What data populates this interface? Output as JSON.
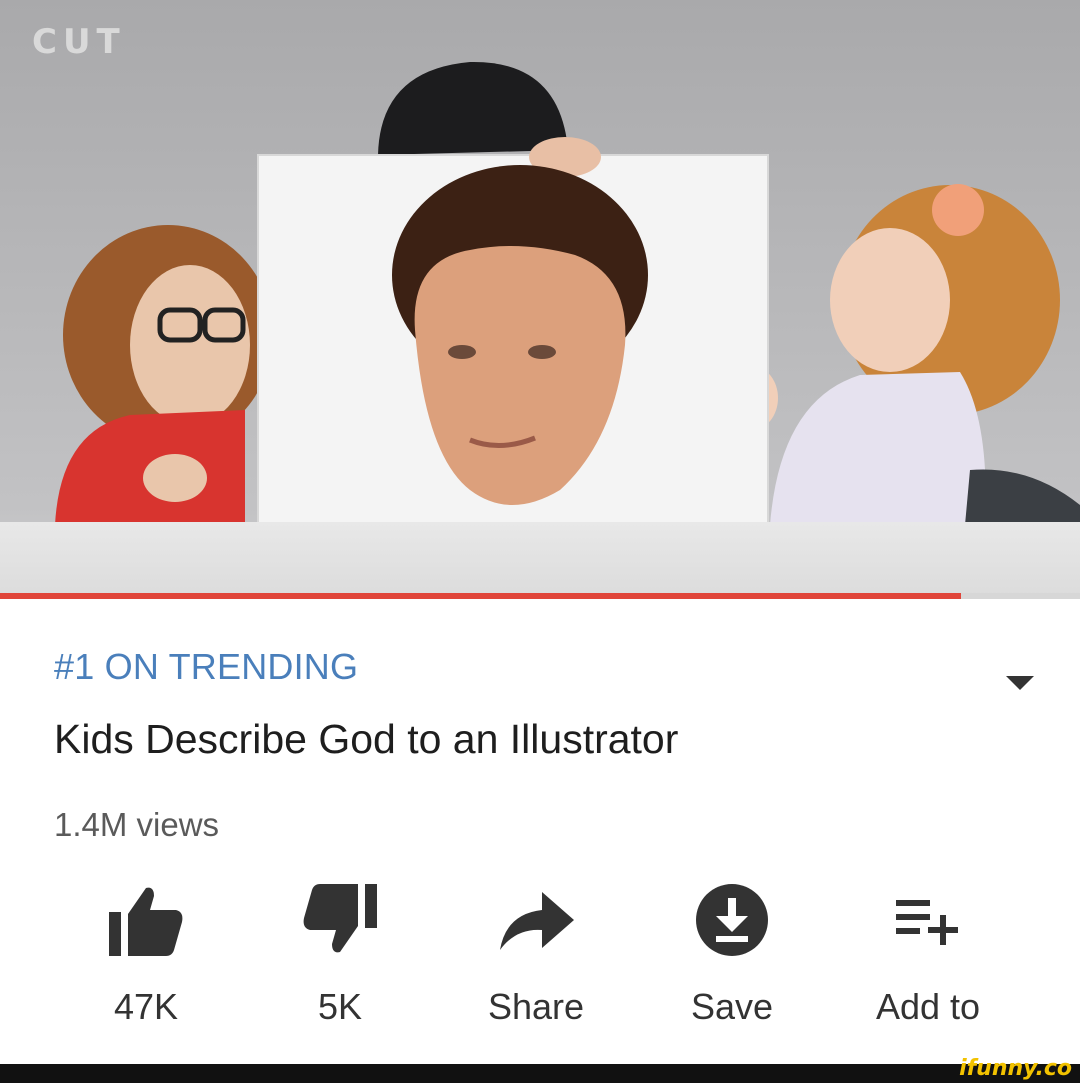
{
  "video": {
    "channel_logo": "CUT",
    "progress_fraction": 0.89
  },
  "info": {
    "trending": "#1 ON TRENDING",
    "title": "Kids Describe God to an Illustrator",
    "views": "1.4M views",
    "expand_icon": "chevron-down-icon"
  },
  "actions": [
    {
      "icon": "thumbs-up-icon",
      "label": "47K"
    },
    {
      "icon": "thumbs-down-icon",
      "label": "5K"
    },
    {
      "icon": "share-icon",
      "label": "Share"
    },
    {
      "icon": "download-icon",
      "label": "Save"
    },
    {
      "icon": "playlist-add-icon",
      "label": "Add to"
    }
  ],
  "colors": {
    "accent_trending": "#4a7fbb",
    "progress": "#e0453a",
    "watermark": "#f2c200"
  },
  "watermark": "ifunny.co"
}
